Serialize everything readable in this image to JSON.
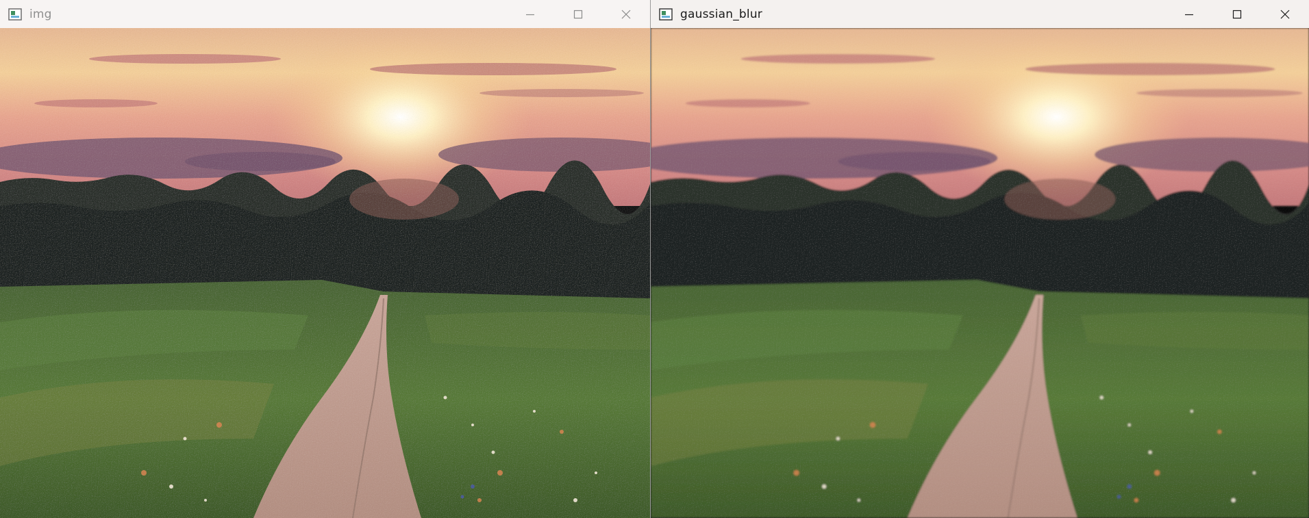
{
  "windows": {
    "left": {
      "title": "img"
    },
    "right": {
      "title": "gaussian_blur"
    }
  },
  "icons": {
    "app": "opencv-window-icon",
    "minimize": "minimize-icon",
    "maximize": "maximize-icon",
    "close": "close-icon"
  },
  "colors": {
    "titlebar": "#f5f2f1",
    "inactive_title": "#8f8f8f",
    "active_title": "#1a1a1a",
    "sky_top": "#e9b98f",
    "sky_glow": "#fff3c8",
    "treeline": "#262a26",
    "field": "#4d6a33",
    "path": "#a98b7c"
  }
}
